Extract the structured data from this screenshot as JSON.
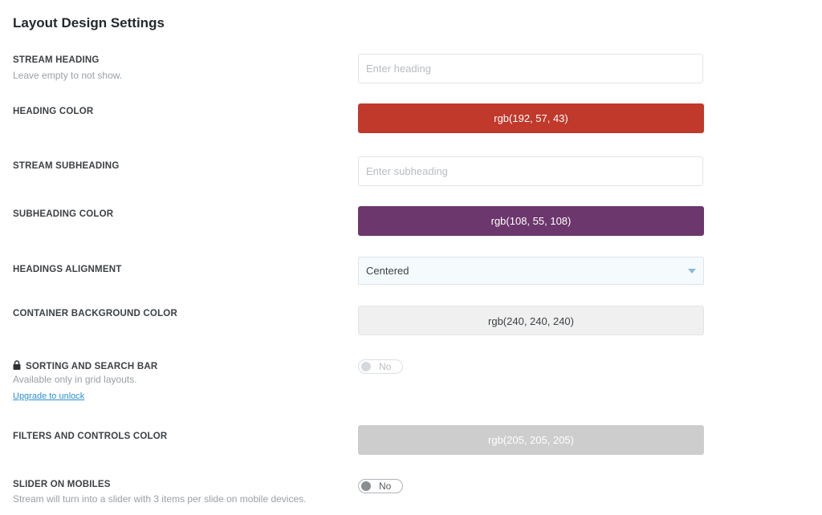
{
  "page": {
    "title": "Layout Design Settings"
  },
  "settings": {
    "stream_heading": {
      "label": "STREAM HEADING",
      "description": "Leave empty to not show.",
      "value": "",
      "placeholder": "Enter heading"
    },
    "heading_color": {
      "label": "HEADING COLOR",
      "value": "rgb(192, 57, 43)",
      "color": "#c0392b",
      "text_color": "#ffffff"
    },
    "stream_subheading": {
      "label": "STREAM SUBHEADING",
      "value": "",
      "placeholder": "Enter subheading"
    },
    "subheading_color": {
      "label": "SUBHEADING COLOR",
      "value": "rgb(108, 55, 108)",
      "color": "#6c376c",
      "text_color": "#ffffff"
    },
    "headings_alignment": {
      "label": "HEADINGS ALIGNMENT",
      "selected": "Centered"
    },
    "container_bg_color": {
      "label": "CONTAINER BACKGROUND COLOR",
      "value": "rgb(240, 240, 240)",
      "color": "#f0f0f0",
      "text_color": "#3c4145"
    },
    "sorting_search_bar": {
      "label": "SORTING AND SEARCH BAR",
      "icon": "lock-icon",
      "description": "Available only in grid layouts.",
      "link": "Upgrade to unlock",
      "toggle_label": "No",
      "enabled": false,
      "locked": true
    },
    "filters_controls_color": {
      "label": "FILTERS AND CONTROLS COLOR",
      "value": "rgb(205, 205, 205)",
      "color": "#cdcdcd",
      "text_color": "#ffffff"
    },
    "slider_on_mobiles": {
      "label": "SLIDER ON MOBILES",
      "description": "Stream will turn into a slider with 3 items per slide on mobile devices.",
      "toggle_label": "No",
      "enabled": false
    }
  }
}
